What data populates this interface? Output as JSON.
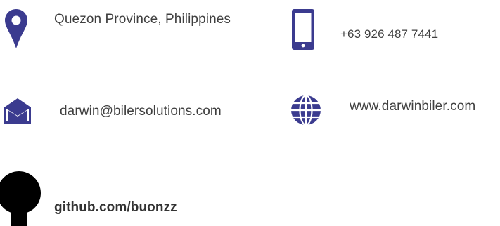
{
  "colors": {
    "accent": "#3b3b8f",
    "github": "#000000"
  },
  "contacts": {
    "location": {
      "icon": "map-pin-icon",
      "text": "Quezon Province,  Philippines"
    },
    "phone": {
      "icon": "mobile-phone-icon",
      "text": "+63 926 487 7441"
    },
    "email": {
      "icon": "envelope-icon",
      "text": "darwin@bilersolutions.com"
    },
    "website": {
      "icon": "globe-icon",
      "text": "www.darwinbiler.com"
    },
    "github": {
      "icon": "github-icon",
      "text": "github.com/buonzz"
    }
  }
}
